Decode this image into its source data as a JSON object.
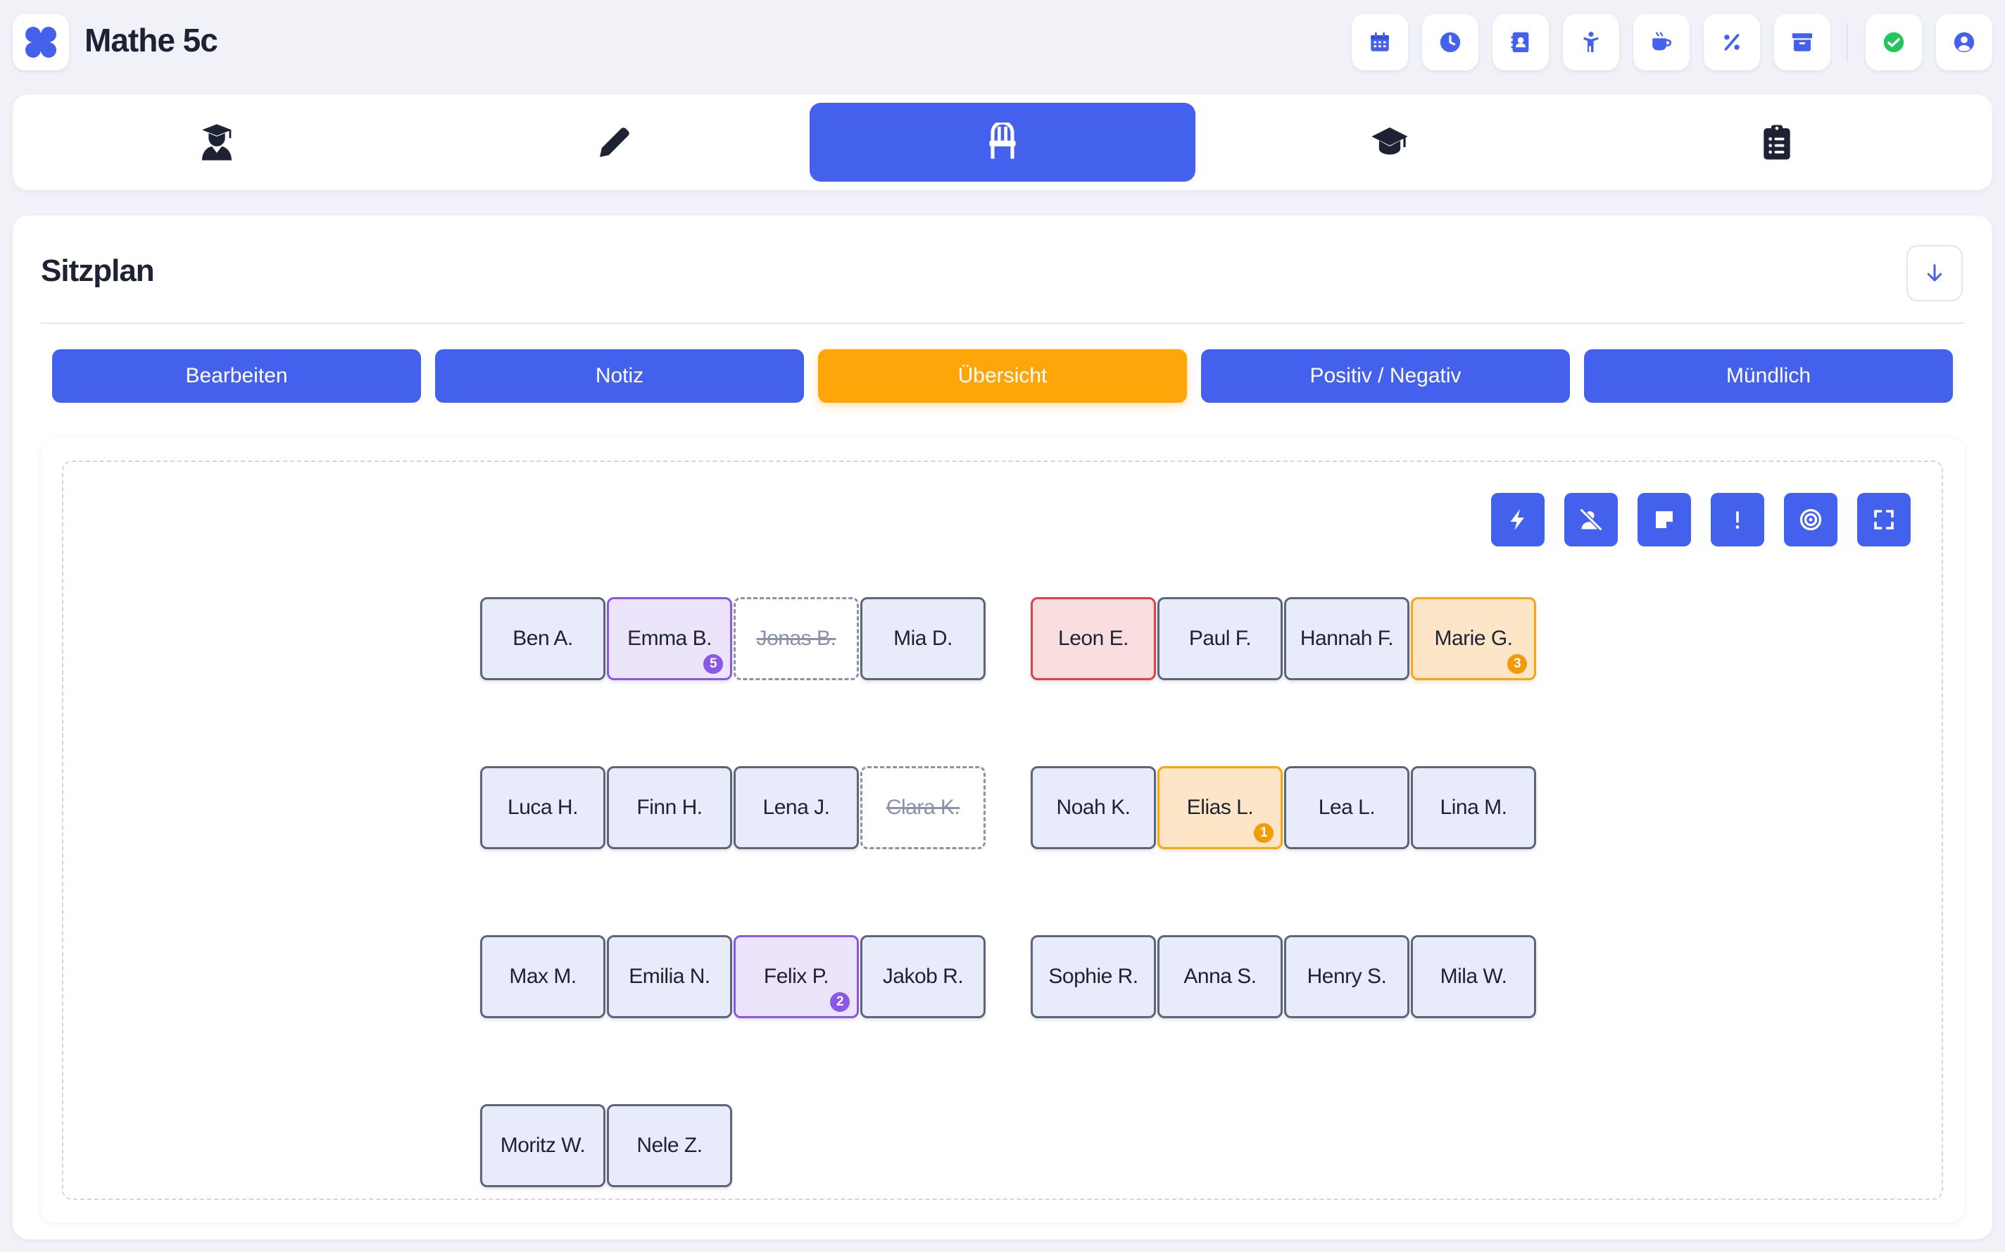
{
  "app": {
    "title": "Mathe 5c"
  },
  "toolbar": {
    "icons": [
      "calendar-icon",
      "clock-icon",
      "contact-book-icon",
      "person-icon",
      "coffee-icon",
      "percent-icon",
      "archive-icon",
      "check-circle-icon",
      "user-circle-icon"
    ],
    "status_color": "#22c55e"
  },
  "nav": {
    "tabs": [
      {
        "icon": "student-icon",
        "active": false
      },
      {
        "icon": "pencil-icon",
        "active": false
      },
      {
        "icon": "chair-icon",
        "active": true
      },
      {
        "icon": "graduation-cap-icon",
        "active": false
      },
      {
        "icon": "clipboard-list-icon",
        "active": false
      }
    ]
  },
  "section": {
    "title": "Sitzplan"
  },
  "modes": {
    "items": [
      "Bearbeiten",
      "Notiz",
      "Übersicht",
      "Positiv / Negativ",
      "Mündlich"
    ],
    "active": "Übersicht"
  },
  "plan_tools": [
    "bolt-icon",
    "user-slash-icon",
    "sticky-note-icon",
    "exclamation-icon",
    "target-icon",
    "expand-icon"
  ],
  "colors": {
    "accent": "#4461ee",
    "active_mode": "#fea50a",
    "purple": "#8b57e8",
    "orange": "#fea50a",
    "red": "#e63f48"
  },
  "seats": [
    {
      "name": "Ben A.",
      "state": "normal"
    },
    {
      "name": "Emma B.",
      "state": "purple",
      "badge": "5"
    },
    {
      "name": "Jonas B.",
      "state": "absent"
    },
    {
      "name": "Mia D.",
      "state": "normal"
    },
    {
      "name": "Leon E.",
      "state": "red"
    },
    {
      "name": "Paul F.",
      "state": "normal"
    },
    {
      "name": "Hannah F.",
      "state": "normal"
    },
    {
      "name": "Marie G.",
      "state": "orange",
      "badge": "3"
    },
    {
      "name": "Luca H.",
      "state": "normal"
    },
    {
      "name": "Finn H.",
      "state": "normal"
    },
    {
      "name": "Lena J.",
      "state": "normal"
    },
    {
      "name": "Clara K.",
      "state": "absent"
    },
    {
      "name": "Noah K.",
      "state": "normal"
    },
    {
      "name": "Elias L.",
      "state": "orange",
      "badge": "1"
    },
    {
      "name": "Lea L.",
      "state": "normal"
    },
    {
      "name": "Lina M.",
      "state": "normal"
    },
    {
      "name": "Max M.",
      "state": "normal"
    },
    {
      "name": "Emilia N.",
      "state": "normal"
    },
    {
      "name": "Felix P.",
      "state": "purple",
      "badge": "2"
    },
    {
      "name": "Jakob R.",
      "state": "normal"
    },
    {
      "name": "Sophie R.",
      "state": "normal"
    },
    {
      "name": "Anna S.",
      "state": "normal"
    },
    {
      "name": "Henry S.",
      "state": "normal"
    },
    {
      "name": "Mila W.",
      "state": "normal"
    },
    {
      "name": "Moritz W.",
      "state": "normal"
    },
    {
      "name": "Nele Z.",
      "state": "normal"
    }
  ]
}
